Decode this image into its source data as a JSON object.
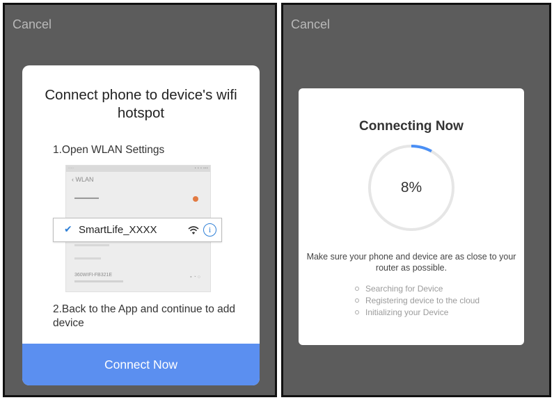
{
  "left_screen": {
    "cancel_label": "Cancel",
    "dialog": {
      "title": "Connect phone to device's wifi hotspot",
      "step1": "1.Open WLAN Settings",
      "step2": "2.Back to the App and continue to add device",
      "button_label": "Connect Now",
      "button_color": "#5b8ff0",
      "illustration": {
        "nav_title": "WLAN",
        "highlighted_network": "SmartLife_XXXX",
        "other_network": "360WIFI-FB321E",
        "icons": [
          "checkmark-icon",
          "wifi-signal-icon",
          "info-icon"
        ]
      }
    }
  },
  "right_screen": {
    "cancel_label": "Cancel",
    "dialog": {
      "title": "Connecting Now",
      "progress_text": "8%",
      "progress_value": 0.08,
      "progress_color": "#4a8ff5",
      "message": "Make sure your phone and device are as close to your router as possible.",
      "steps": [
        "Searching for Device",
        "Registering device to the cloud",
        "Initializing your Device"
      ]
    }
  }
}
